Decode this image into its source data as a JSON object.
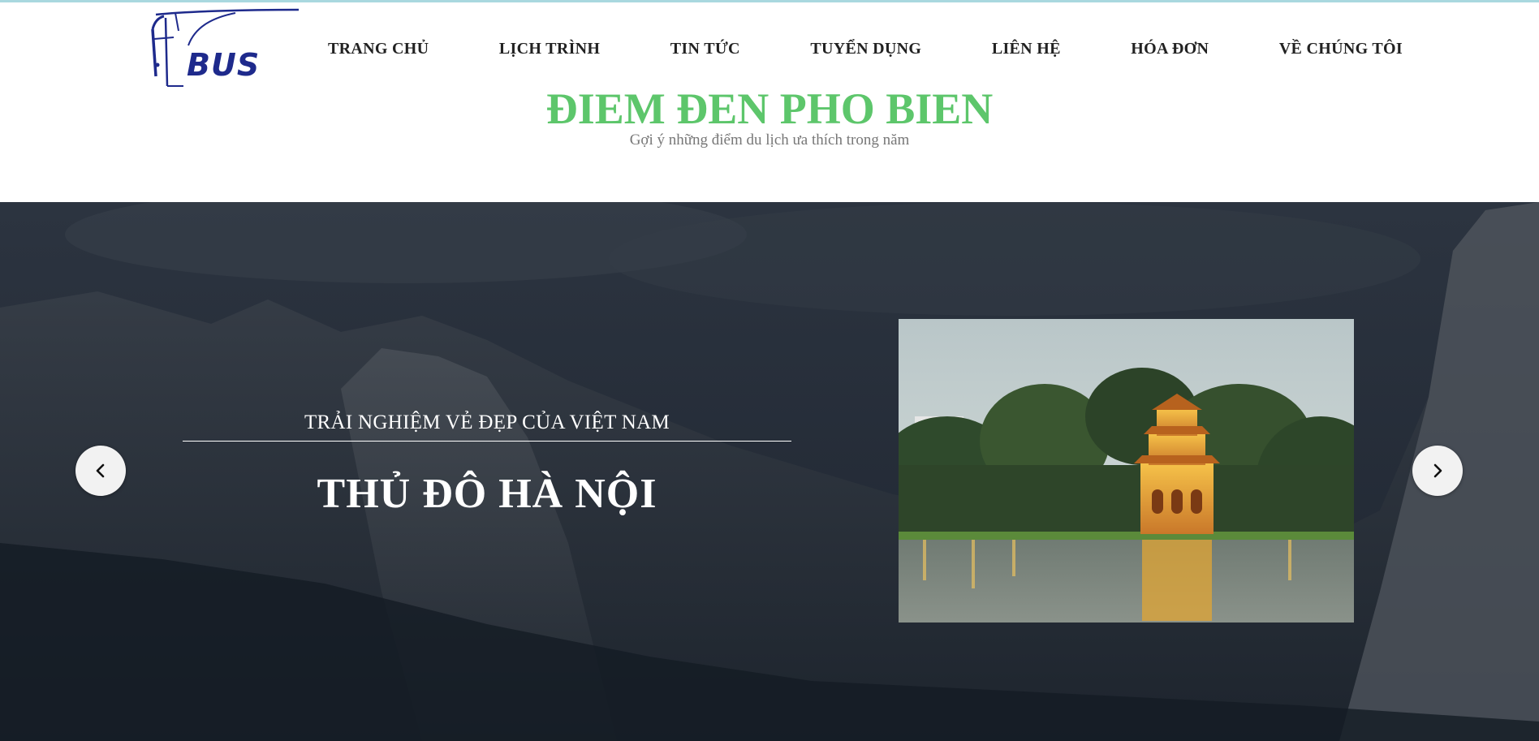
{
  "brand": {
    "logo_text": "BUS",
    "logo_color": "#1e2a8c"
  },
  "nav": {
    "items": [
      {
        "label": "TRANG CHỦ"
      },
      {
        "label": "LỊCH TRÌNH"
      },
      {
        "label": "TIN TỨC"
      },
      {
        "label": "TUYỂN DỤNG"
      },
      {
        "label": "LIÊN HỆ"
      },
      {
        "label": "HÓA ĐƠN"
      },
      {
        "label": "VỀ CHÚNG TÔI"
      }
    ]
  },
  "section": {
    "title": "ĐIEM ĐEN PHO BIEN",
    "subtitle": "Gợi ý những điểm du lịch ưa thích trong năm",
    "title_color": "#5dc66b"
  },
  "slider": {
    "kicker": "TRẢI NGHIỆM VẺ ĐẸP CỦA VIỆT NAM",
    "title": "THỦ ĐÔ HÀ NỘI",
    "prev_icon": "chevron-left-icon",
    "next_icon": "chevron-right-icon"
  }
}
